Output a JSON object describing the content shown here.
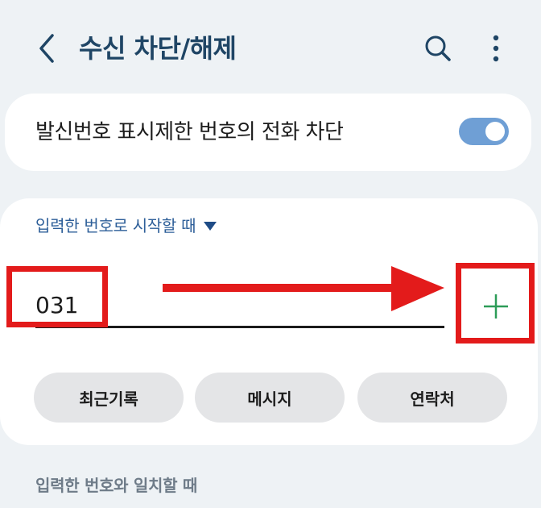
{
  "header": {
    "title": "수신 차단/해제"
  },
  "icons": {
    "back": "chevron-left-icon",
    "search": "search-icon",
    "more": "more-vertical-icon",
    "add": "plus-icon"
  },
  "block_unknown": {
    "label": "발신번호 표시제한 번호의 전화 차단",
    "enabled": true
  },
  "block_card": {
    "dropdown_label": "입력한 번호로 시작할 때",
    "number_input": {
      "value": "031",
      "placeholder": ""
    },
    "chips": [
      {
        "label": "최근기록"
      },
      {
        "label": "메시지"
      },
      {
        "label": "연락처"
      }
    ]
  },
  "section_label": "입력한 번호와 일치할 때",
  "colors": {
    "title": "#1f4565",
    "toggle_on": "#6f9fd5",
    "dropdown_text": "#2e5f99",
    "add_icon": "#2d9c58",
    "annotation": "#e31b1b",
    "background": "#eef2f5"
  }
}
